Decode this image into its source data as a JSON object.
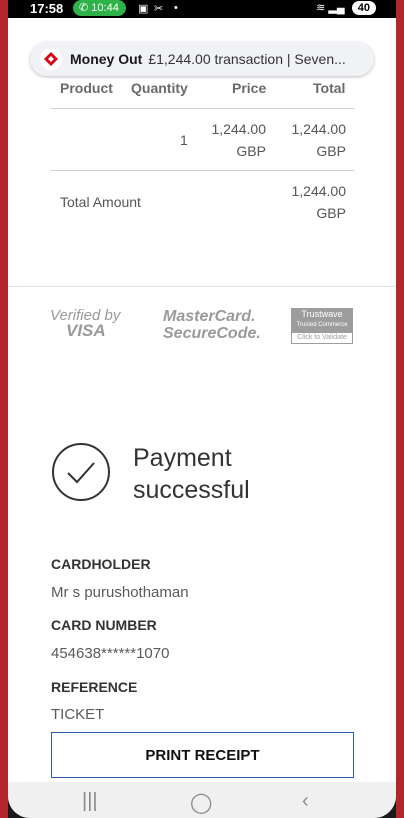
{
  "status_bar": {
    "time": "17:58",
    "call_timer": "10:44",
    "battery": "40"
  },
  "notification": {
    "title": "Money Out",
    "message": "£1,244.00 transaction | Seven..."
  },
  "table": {
    "headers": [
      "Product",
      "Quantity",
      "Price",
      "Total"
    ],
    "row": {
      "quantity": "1",
      "price_amount": "1,244.00",
      "price_currency": "GBP",
      "total_amount": "1,244.00",
      "total_currency": "GBP"
    },
    "total_label": "Total Amount",
    "total_value_amount": "1,244.00",
    "total_value_currency": "GBP"
  },
  "security_logos": {
    "verified_by": "Verified by",
    "visa": "VISA",
    "mastercard_1": "MasterCard.",
    "mastercard_2": "SecureCode.",
    "trustwave_1": "Trustwave",
    "trustwave_2": "Trusted Commerce",
    "trustwave_3": "Click to Validate"
  },
  "result": {
    "line1": "Payment",
    "line2": "successful"
  },
  "details": {
    "cardholder_label": "CARDHOLDER",
    "cardholder_value": "Mr s purushothaman",
    "card_number_label": "CARD NUMBER",
    "card_number_value": "454638******1070",
    "reference_label": "REFERENCE",
    "reference_value": "TICKET"
  },
  "actions": {
    "print_receipt": "PRINT RECEIPT"
  },
  "colors": {
    "accent_border": "#2c5ea8",
    "frame": "#b3262c",
    "call_pill": "#2fb14a"
  }
}
